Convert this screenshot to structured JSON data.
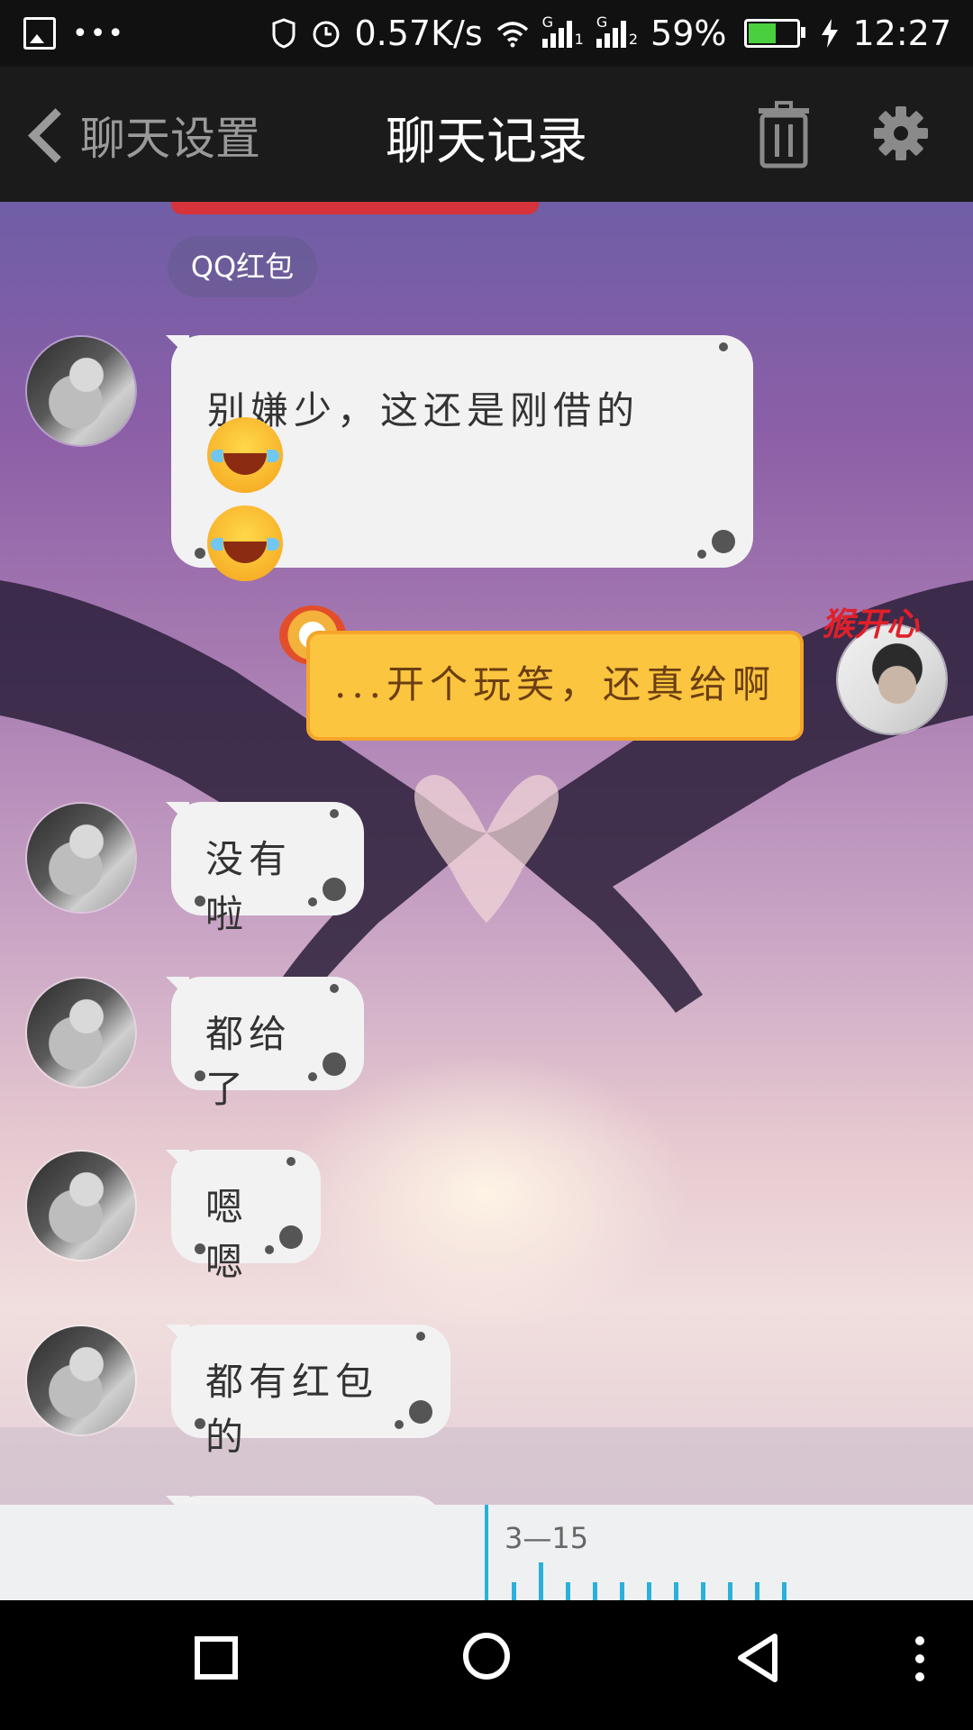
{
  "status_bar": {
    "net_speed": "0.57K/s",
    "battery": "59%",
    "battery_level": 0.59,
    "time": "12:27",
    "sim1_label": "G",
    "sim2_label": "G",
    "sim1_index": "1",
    "sim2_index": "2"
  },
  "header": {
    "back_label": "聊天设置",
    "title": "聊天记录"
  },
  "chat": {
    "red_packet_label": "QQ红包",
    "messages": [
      {
        "text": "别嫌少，这还是刚借的"
      },
      {
        "text": "...开个玩笑，还真给啊"
      },
      {
        "text": "没有啦"
      },
      {
        "text": "都给了"
      },
      {
        "text": "嗯嗯"
      },
      {
        "text": "都有红包的"
      }
    ],
    "my_avatar_badge": "猴开心"
  },
  "timeline": {
    "date": "3—15"
  },
  "colors": {
    "accent": "#2bb0d9",
    "yellow_bubble": "#fcc53f",
    "header_bg": "#1b1b1b"
  }
}
